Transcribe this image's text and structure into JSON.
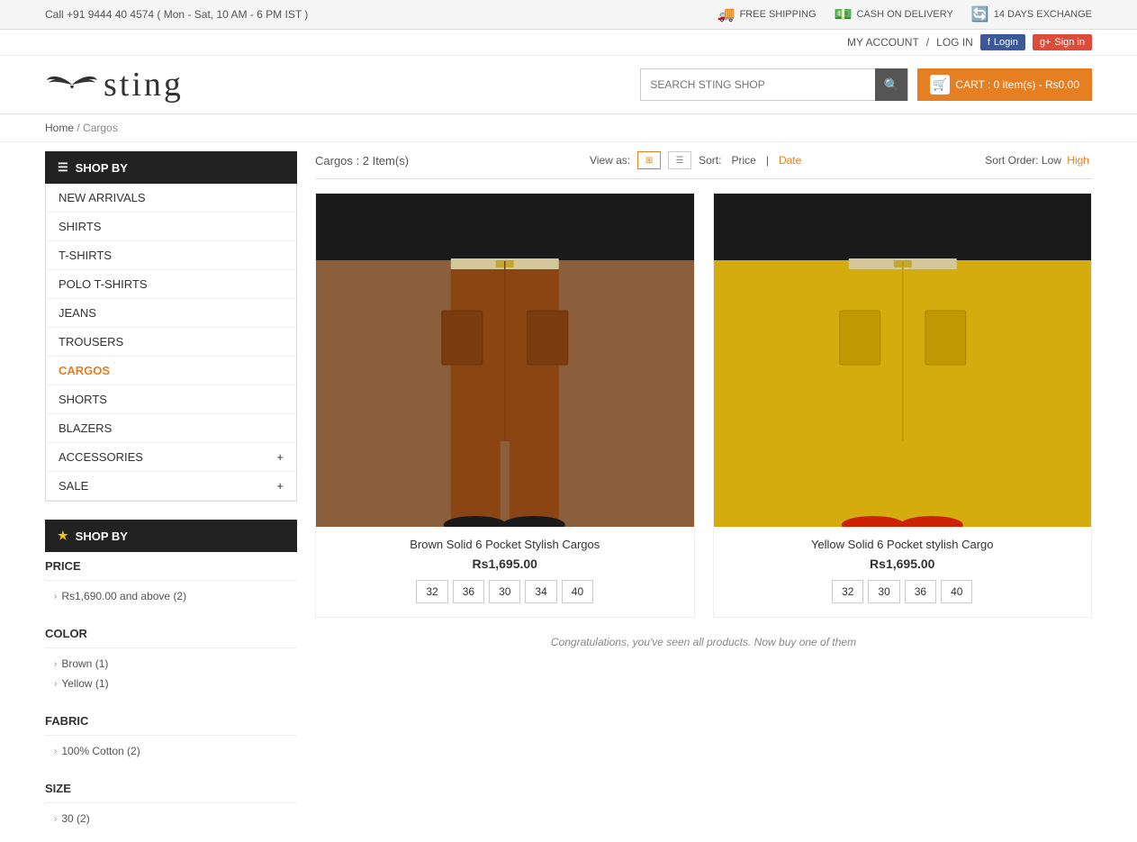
{
  "topbar": {
    "phone": "Call +91 9444 40 4574 ( Mon - Sat, 10 AM - 6 PM IST )",
    "features": [
      {
        "id": "free-shipping",
        "icon": "🚚",
        "label": "FREE SHIPPING"
      },
      {
        "id": "cash-on-delivery",
        "icon": "💵",
        "label": "CASH ON DELIVERY"
      },
      {
        "id": "exchange",
        "icon": "🔄",
        "label": "14 DAYS EXCHANGE"
      }
    ]
  },
  "header": {
    "logo_text": "sting",
    "search_placeholder": "SEARCH STING SHOP",
    "cart_label": "CART : 0 item(s) - Rs0.00",
    "account_label": "MY ACCOUNT",
    "login_label": "LOG IN",
    "fb_login": "Login",
    "google_login": "Sign in"
  },
  "breadcrumb": {
    "home": "Home",
    "current": "Cargos"
  },
  "sidebar": {
    "shop_by_label": "SHOP BY",
    "featured_label": "SHOP BY",
    "nav_items": [
      {
        "id": "new-arrivals",
        "label": "NEW ARRIVALS",
        "active": false
      },
      {
        "id": "shirts",
        "label": "SHIRTS",
        "active": false
      },
      {
        "id": "t-shirts",
        "label": "T-SHIRTS",
        "active": false
      },
      {
        "id": "polo-t-shirts",
        "label": "POLO T-SHIRTS",
        "active": false
      },
      {
        "id": "jeans",
        "label": "JEANS",
        "active": false
      },
      {
        "id": "trousers",
        "label": "TROUSERS",
        "active": false
      },
      {
        "id": "cargos",
        "label": "CARGOS",
        "active": true
      },
      {
        "id": "shorts",
        "label": "SHORTS",
        "active": false
      },
      {
        "id": "blazers",
        "label": "BLAZERS",
        "active": false
      },
      {
        "id": "accessories",
        "label": "ACCESSORIES",
        "active": false,
        "has_plus": true
      },
      {
        "id": "sale",
        "label": "SALE",
        "active": false,
        "has_plus": true
      }
    ],
    "price_filter": {
      "title": "PRICE",
      "items": [
        {
          "label": "Rs1,690.00 and above (2)"
        }
      ]
    },
    "color_filter": {
      "title": "COLOR",
      "items": [
        {
          "label": "Brown (1)"
        },
        {
          "label": "Yellow (1)"
        }
      ]
    },
    "fabric_filter": {
      "title": "FABRIC",
      "items": [
        {
          "label": "100% Cotton (2)"
        }
      ]
    },
    "size_filter": {
      "title": "SIZE",
      "items": [
        {
          "label": "30 (2)"
        }
      ]
    }
  },
  "toolbar": {
    "item_count": "Cargos : 2 Item(s)",
    "view_as": "View as:",
    "sort_label": "Sort:",
    "sort_price": "Price",
    "sort_separator": "|",
    "sort_date": "Date",
    "sort_order_label": "Sort Order: Low",
    "sort_order_high": "High"
  },
  "products": [
    {
      "id": "brown-cargo",
      "name": "Brown Solid 6 Pocket Stylish Cargos",
      "price": "Rs1,695.00",
      "color": "brown",
      "sizes": [
        "32",
        "36",
        "30",
        "34",
        "40"
      ]
    },
    {
      "id": "yellow-cargo",
      "name": "Yellow Solid 6 Pocket stylish Cargo",
      "price": "Rs1,695.00",
      "color": "yellow",
      "sizes": [
        "32",
        "30",
        "36",
        "40"
      ]
    }
  ],
  "footer_msg": "Congratulations, you've seen all products. Now buy one of them"
}
